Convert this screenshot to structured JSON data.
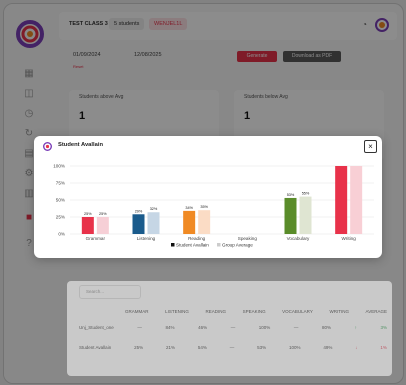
{
  "topbar": {
    "class_name": "TEST CLASS 3",
    "students_badge": "5 students",
    "tag": "WENJEL1L"
  },
  "toolbar": {
    "start_date": "01/09/2024",
    "end_date": "12/08/2025",
    "reset": "Reset",
    "generate": "Generate",
    "download": "Download as PDF"
  },
  "cards": [
    {
      "title": "Students above Avg",
      "value": "1"
    },
    {
      "title": "Students below Avg",
      "value": "1"
    }
  ],
  "table": {
    "search_placeholder": "Search...",
    "headers": [
      "GRAMMAR",
      "LISTENING",
      "READING",
      "SPEAKING",
      "VOCABULARY",
      "WRITING",
      "AVERAGE"
    ],
    "rows": [
      {
        "name": "Unj_Student_one",
        "cells": [
          "—",
          "84%",
          "46%",
          "—",
          "100%",
          "—"
        ],
        "avg": "80%",
        "trend": "↑",
        "trend_val": "3%"
      },
      {
        "name": "Student Avallain",
        "cells": [
          "25%",
          "21%",
          "54%",
          "—",
          "53%",
          "100%"
        ],
        "avg": "49%",
        "trend": "↓",
        "trend_val": "1%"
      }
    ]
  },
  "modal": {
    "title": "Student Avallain",
    "close": "×"
  },
  "colors": {
    "accent": "#e8324a"
  },
  "chart_data": {
    "type": "bar",
    "categories": [
      "Grammar",
      "Listening",
      "Reading",
      "Speaking",
      "Vocabulary",
      "Writing"
    ],
    "ylim": [
      0,
      100
    ],
    "yticks": [
      "100%",
      "75%",
      "50%",
      "25%",
      "0%"
    ],
    "series": [
      {
        "name": "Student Avallain",
        "colors": [
          "#e8324a",
          "#1a5b8c",
          "#f08a24",
          "#999999",
          "#5a8c2a",
          "#e8324a"
        ],
        "values": [
          25,
          29,
          34,
          null,
          53,
          100
        ]
      },
      {
        "name": "Group Average",
        "colors": [
          "#f6cfd6",
          "#c6d6e5",
          "#fbdcc5",
          "#dddddd",
          "#dfe5d2",
          "#f8cfd5"
        ],
        "values": [
          25,
          32,
          35,
          null,
          55,
          100
        ]
      }
    ],
    "data_labels": [
      [
        "25%",
        "29%",
        "34%",
        "",
        "53%",
        ""
      ],
      [
        "25%",
        "32%",
        "35%",
        "",
        "55%",
        ""
      ]
    ]
  }
}
